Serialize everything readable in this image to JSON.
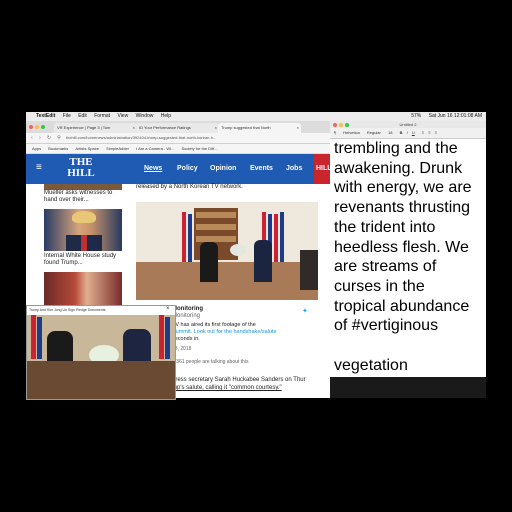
{
  "menubar": {
    "app": "TextEdit",
    "items": [
      "File",
      "Edit",
      "Format",
      "View",
      "Window",
      "Help"
    ],
    "battery": "57%",
    "clock": "Sat Jun 16  12:01:08 AM"
  },
  "browser": {
    "tabs": [
      {
        "title": "VR Experience | Page 3 | Tom"
      },
      {
        "title": "ID Your Performance Ratings"
      },
      {
        "title": "Trump suggested that North"
      }
    ],
    "url": "thehill.com/homenews/administration/392404-trump-suggested-that-north-korean-h...",
    "bookmarks": [
      "Apps",
      "Bookmarks",
      "Artists Space",
      "SimpleAdder",
      "I Am a Camera - Wi...",
      "Society for the Diff..."
    ],
    "site": {
      "logo_top": "THE",
      "logo_bottom": "HILL",
      "nav": [
        "News",
        "Policy",
        "Opinion",
        "Events",
        "Jobs",
        "HILL"
      ],
      "side_stories": [
        {
          "caption": "Mueller asks witnesses to hand over their..."
        },
        {
          "caption": "Internal White House study found Trump..."
        }
      ],
      "lead_caption": "released by a North Korean TV network.",
      "tweet": {
        "account": "Monitoring",
        "handle": "Monitoring",
        "text_lines": [
          "TV has aired its first footage of the",
          "Summit. Look out for the handshake/salute",
          "seconds in."
        ],
        "date": "13, 2018",
        "people": "2,361 people are talking about this"
      },
      "body_lines": [
        "press secretary Sarah Huckabee Sanders on Thur",
        "mp's salute, calling it \"common courtesy.\""
      ]
    }
  },
  "pip": {
    "title": "Trump And Kim Jong Un Sign Pledge Documents"
  },
  "textedit": {
    "window_title": "Untitled 2",
    "font": "Helvetica",
    "style": "Regular",
    "size": "18",
    "body": "trembling and the\nawakening. Drunk\nwith energy, we are\nrevenants thrusting\nthe trident into\nheedless flesh. We\nare streams of\ncurses in the\ntropical abundance\nof #vertiginous\n\nvegetation"
  },
  "colors": {
    "site_blue": "#1f5bb3",
    "site_red": "#c8252c"
  }
}
